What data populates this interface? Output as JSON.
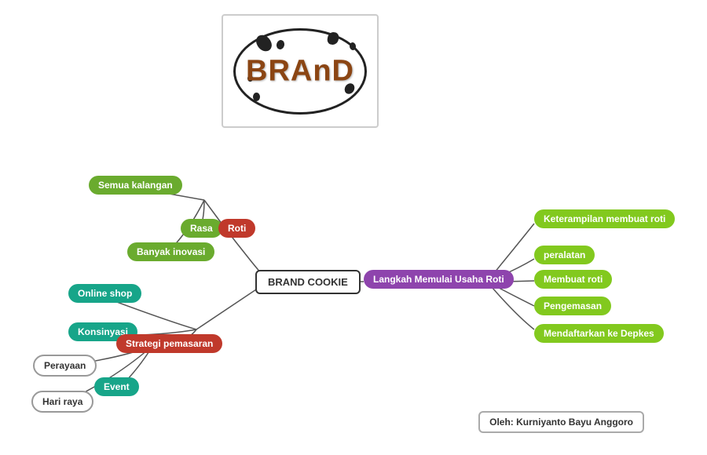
{
  "logo": {
    "brand_text": "BRAnD",
    "border_color": "#222"
  },
  "nodes": {
    "brand_cookie": "BRAND COOKIE",
    "langkah": "Langkah Memulai Usaha Roti",
    "semua_kalangan": "Semua kalangan",
    "rasa": "Rasa",
    "roti_label": "Roti",
    "banyak_inovasi": "Banyak inovasi",
    "online_shop": "Online shop",
    "konsinyasi": "Konsinyasi",
    "strategi_pemasaran": "Strategi pemasaran",
    "perayaan": "Perayaan",
    "event": "Event",
    "hari_raya": "Hari raya",
    "keterampilan": "Keterampilan membuat roti",
    "peralatan": "peralatan",
    "membuat_roti": "Membuat roti",
    "pengemasan": "Pengemasan",
    "mendaftarkan": "Mendaftarkan ke Depkes",
    "credit": "Oleh: Kurniyanto Bayu Anggoro"
  }
}
